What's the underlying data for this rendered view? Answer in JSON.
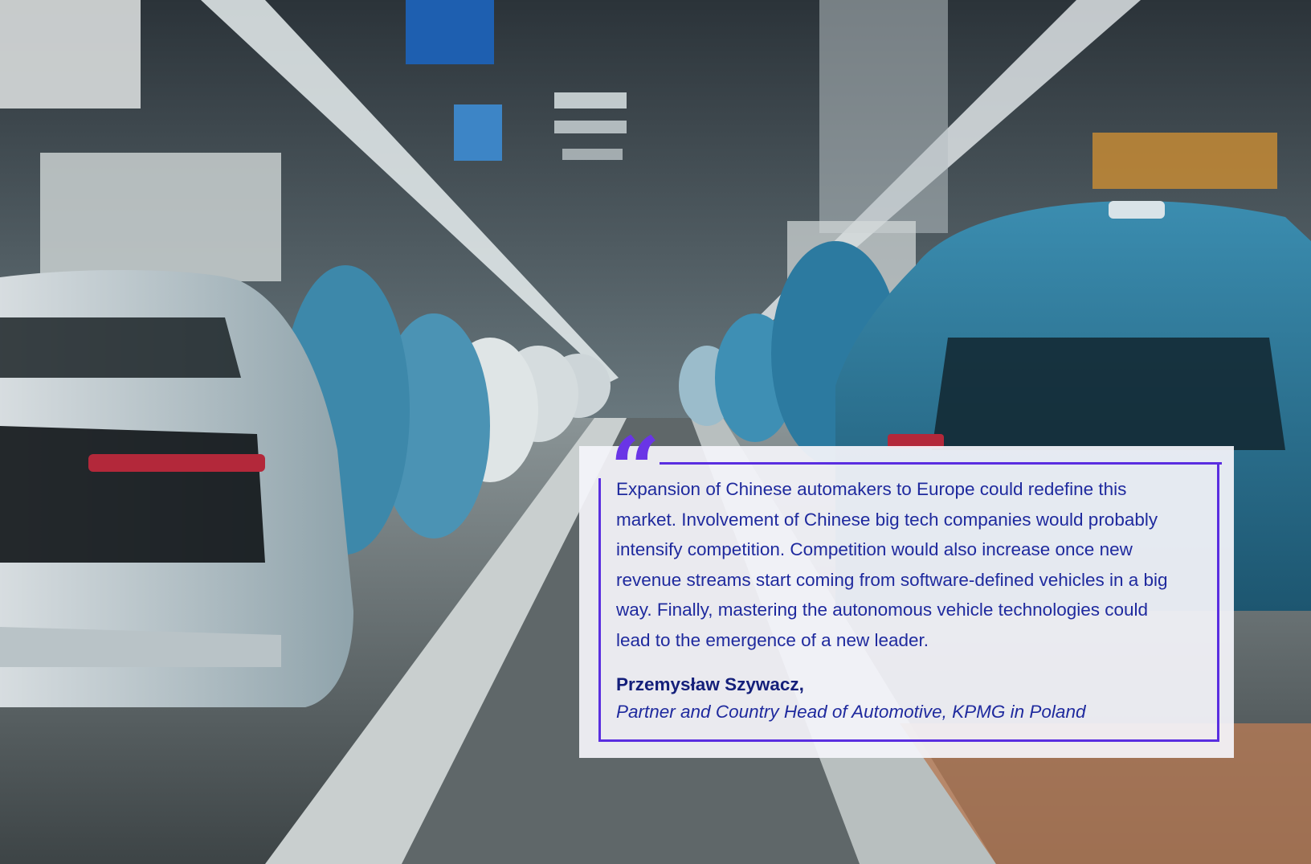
{
  "scene": {
    "description_icon": "factory-assembly-line-photo"
  },
  "quote": {
    "mark_icon": "quotation-mark-icon",
    "text": "Expansion of Chinese automakers to Europe could redefine this market. Involvement of Chinese big tech companies would probably intensify competition. Competition would also increase once new revenue streams start coming from software-defined vehicles in a big way. Finally, mastering the autonomous vehicle technologies could lead to the emergence of a new leader.",
    "author_name": "Przemysław Szywacz,",
    "author_role": "Partner and Country Head of Automotive, KPMG in Poland"
  },
  "colors": {
    "accent": "#5a2ee0",
    "quote_text": "#1f2a9e",
    "card_bg": "#f4f4fa"
  }
}
